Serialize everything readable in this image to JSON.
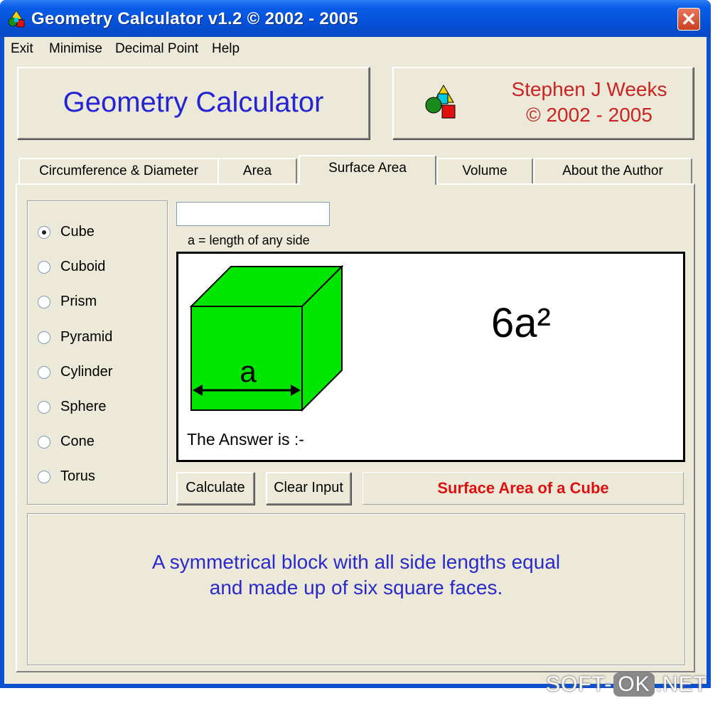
{
  "window": {
    "title": "Geometry Calculator v1.2 ©  2002 - 2005",
    "close_glyph": "✕"
  },
  "menu": [
    "Exit",
    "Minimise",
    "Decimal Point",
    "Help"
  ],
  "header": {
    "app_name": "Geometry Calculator",
    "author_name": "Stephen J Weeks",
    "author_years": "© 2002 - 2005"
  },
  "tabs": [
    {
      "label": "Circumference & Diameter",
      "active": false
    },
    {
      "label": "Area",
      "active": false
    },
    {
      "label": "Surface Area",
      "active": true
    },
    {
      "label": "Volume",
      "active": false
    },
    {
      "label": "About the Author",
      "active": false
    }
  ],
  "shapes": [
    {
      "label": "Cube",
      "selected": true
    },
    {
      "label": "Cuboid",
      "selected": false
    },
    {
      "label": "Prism",
      "selected": false
    },
    {
      "label": "Pyramid",
      "selected": false
    },
    {
      "label": "Cylinder",
      "selected": false
    },
    {
      "label": "Sphere",
      "selected": false
    },
    {
      "label": "Cone",
      "selected": false
    },
    {
      "label": "Torus",
      "selected": false
    }
  ],
  "input": {
    "value": "",
    "hint": "a = length of any side"
  },
  "diagram": {
    "side_label": "a",
    "formula": "6a²",
    "answer_text": "The Answer is :-",
    "cube_color": "#00e600"
  },
  "buttons": {
    "calculate": "Calculate",
    "clear": "Clear Input"
  },
  "result_title": "Surface Area of a Cube",
  "description": [
    "A symmetrical block with all side lengths equal",
    "and made up of six square faces."
  ],
  "watermark": {
    "left": "SOFT-",
    "box": "OK",
    "right": ".NET"
  },
  "colors": {
    "accent_blue": "#2424d4",
    "accent_red": "#cc2222",
    "titlebar": "#0551d8",
    "face": "#ece9d8"
  }
}
